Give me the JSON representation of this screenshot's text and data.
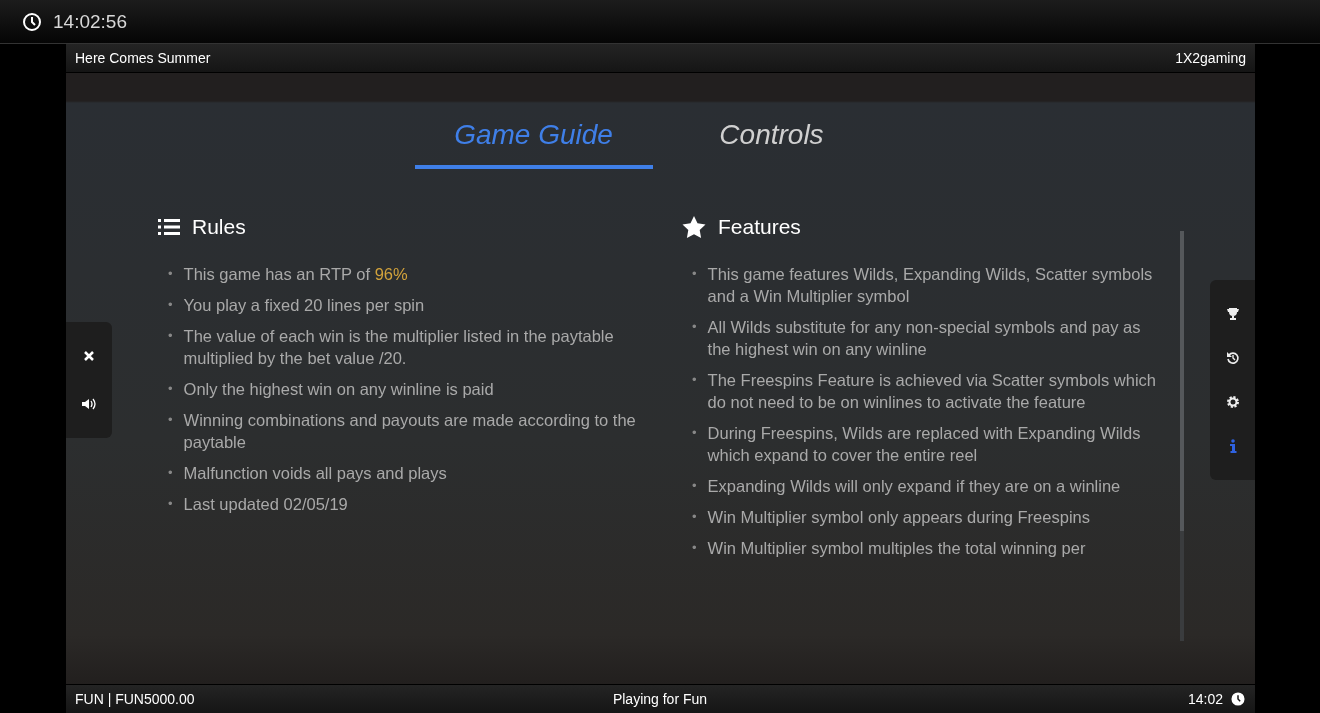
{
  "top_bar": {
    "time": "14:02:56"
  },
  "header": {
    "title": "Here Comes Summer",
    "brand": "1X2gaming"
  },
  "tabs": [
    {
      "label": "Game Guide",
      "selected": true
    },
    {
      "label": "Controls",
      "selected": false
    }
  ],
  "left_panel": [
    {
      "kind": "close"
    },
    {
      "kind": "sound"
    }
  ],
  "right_panel": [
    {
      "kind": "trophy",
      "selected": false
    },
    {
      "kind": "history",
      "selected": false
    },
    {
      "kind": "settings",
      "selected": false
    },
    {
      "kind": "info",
      "selected": true
    }
  ],
  "sections": [
    {
      "kind": "list",
      "title": "Rules",
      "bullet": "•",
      "items": [
        {
          "text": "This game has an RTP of ",
          "highlight": "96%"
        },
        "You play a fixed 20 lines per spin",
        "The value of each win is the multiplier listed in the paytable multiplied by the bet value /20.",
        "Only the highest win on any winline is paid",
        "Winning combinations and payouts are made according to the paytable",
        "Malfunction voids all pays and plays",
        "Last updated 02/05/19"
      ]
    },
    {
      "kind": "star",
      "title": "Features",
      "bullet": "•",
      "items": [
        "This game features Wilds, Expanding Wilds, Scatter symbols and a Win Multiplier symbol",
        "All Wilds substitute for any non-special symbols and pay as the highest win on any winline",
        "The Freespins Feature is achieved via Scatter symbols which do not need to be on winlines to activate the feature",
        "During Freespins, Wilds are replaced with Expanding Wilds which expand to cover the entire reel",
        "Expanding Wilds will only expand if they are on a winline",
        "Win Multiplier symbol only appears during Freespins",
        "Win Multiplier symbol multiples the total winning per"
      ]
    }
  ],
  "footer": {
    "balance": "FUN | FUN5000.00",
    "mode": "Playing for Fun",
    "time": "14:02"
  }
}
